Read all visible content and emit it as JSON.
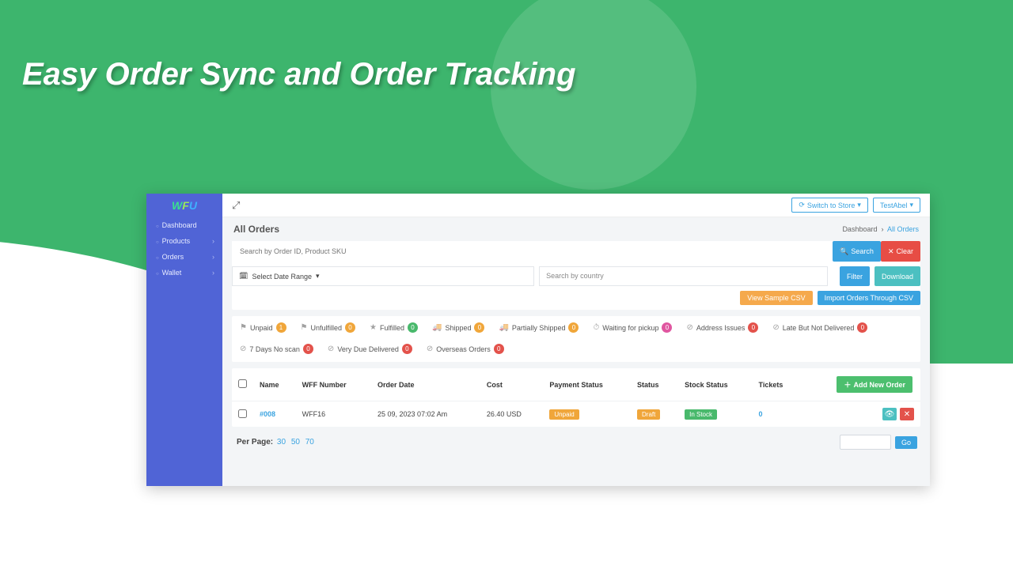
{
  "hero": {
    "title": "Easy Order Sync and Order Tracking"
  },
  "brand": {
    "p1": "W",
    "p2": "F",
    "p3": "U"
  },
  "nav": {
    "dashboard": "Dashboard",
    "products": "Products",
    "orders": "Orders",
    "wallet": "Wallet"
  },
  "topbar": {
    "switch_store": "Switch to Store",
    "user": "TestAbel"
  },
  "page": {
    "title": "All Orders",
    "crumb_home": "Dashboard",
    "crumb_current": "All Orders"
  },
  "search": {
    "placeholder": "Search by Order ID, Product SKU",
    "search_btn": "Search",
    "clear_btn": "Clear",
    "date_range": "Select Date Range",
    "country_ph": "Search by country",
    "filter": "Filter",
    "download": "Download",
    "view_sample": "View Sample CSV",
    "import_csv": "Import Orders Through CSV"
  },
  "filters": [
    {
      "label": "Unpaid",
      "count": "1",
      "cls": "c-orange",
      "ico": "⚑"
    },
    {
      "label": "Unfulfilled",
      "count": "0",
      "cls": "c-orange",
      "ico": "⚑"
    },
    {
      "label": "Fulfilled",
      "count": "0",
      "cls": "c-green",
      "ico": "★"
    },
    {
      "label": "Shipped",
      "count": "0",
      "cls": "c-orange",
      "ico": "🚚"
    },
    {
      "label": "Partially Shipped",
      "count": "0",
      "cls": "c-orange",
      "ico": "🚚"
    },
    {
      "label": "Waiting for pickup",
      "count": "0",
      "cls": "c-pink",
      "ico": "⏱"
    },
    {
      "label": "Address Issues",
      "count": "0",
      "cls": "c-red",
      "ico": "⊘"
    },
    {
      "label": "Late But Not Delivered",
      "count": "0",
      "cls": "c-red",
      "ico": "⊘"
    },
    {
      "label": "7 Days No scan",
      "count": "0",
      "cls": "c-red",
      "ico": "⊘"
    },
    {
      "label": "Very Due Delivered",
      "count": "0",
      "cls": "c-red",
      "ico": "⊘"
    },
    {
      "label": "Overseas Orders",
      "count": "0",
      "cls": "c-red",
      "ico": "⊘"
    }
  ],
  "table": {
    "add_btn": "Add New Order",
    "cols": {
      "name": "Name",
      "wff": "WFF Number",
      "date": "Order Date",
      "cost": "Cost",
      "pay": "Payment Status",
      "status": "Status",
      "stock": "Stock Status",
      "tickets": "Tickets"
    },
    "rows": [
      {
        "name": "#008",
        "wff": "WFF16",
        "date": "25 09, 2023 07:02 Am",
        "cost": "26.40 USD",
        "pay": "Unpaid",
        "status": "Draft",
        "stock": "In Stock",
        "tickets": "0"
      }
    ]
  },
  "pager": {
    "label": "Per Page:",
    "a": "30",
    "b": "50",
    "c": "70",
    "go": "Go"
  }
}
